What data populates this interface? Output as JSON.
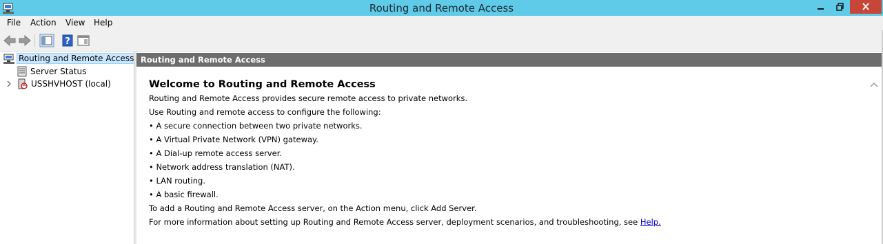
{
  "window": {
    "title": "Routing and Remote Access",
    "controls": {
      "minimize": "minimize",
      "maximize": "restore",
      "close": "close"
    }
  },
  "menu": [
    "File",
    "Action",
    "View",
    "Help"
  ],
  "toolbar": {
    "icons": [
      "back-arrow-icon",
      "forward-arrow-icon",
      "show-hide-console-tree-icon",
      "help-icon",
      "action-pane-icon"
    ]
  },
  "tree": {
    "root": {
      "label": "Routing and Remote Access",
      "selected": true
    },
    "children": [
      {
        "label": "Server Status",
        "expandable": false
      },
      {
        "label": "USSHVHOST (local)",
        "expandable": true
      }
    ]
  },
  "main": {
    "header": "Routing and Remote Access",
    "heading": "Welcome to Routing and Remote Access",
    "intro": "Routing and Remote Access provides secure remote access to private networks.",
    "configure_line": "Use Routing and remote access to configure the following:",
    "bullets": [
      "• A secure connection between two private networks.",
      "• A Virtual Private Network (VPN) gateway.",
      "• A Dial-up remote access server.",
      "• Network address translation (NAT).",
      "• LAN routing.",
      "• A basic firewall."
    ],
    "add_server_line": "To add a Routing and Remote Access server, on the Action menu, click Add Server.",
    "more_info_prefix": "For more information about setting up Routing and Remote Access server, deployment scenarios, and troubleshooting, see ",
    "help_link": "Help."
  },
  "colors": {
    "titlebar": "#5fcbe8",
    "close_button": "#c7463a",
    "header_bar": "#6d6d6d",
    "selection": "#cce8ff",
    "link": "#0000cc"
  }
}
